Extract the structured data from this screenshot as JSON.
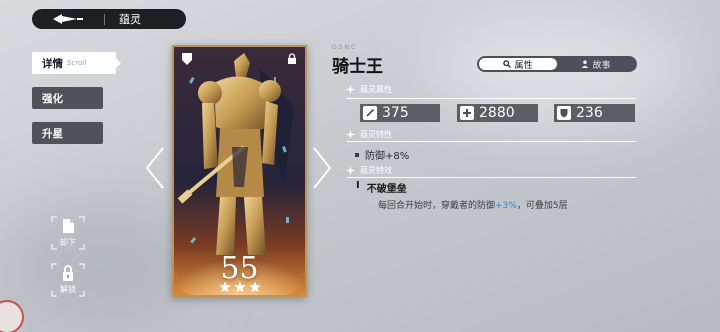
{
  "topbar": {
    "title": "蕴灵"
  },
  "nav": [
    {
      "label": "详情",
      "sub": "Scroll",
      "active": true
    },
    {
      "label": "强化",
      "active": false
    },
    {
      "label": "升星",
      "active": false
    }
  ],
  "side_actions": {
    "unequip_label": "卸下",
    "unlock_label": "解锁"
  },
  "card": {
    "level": "55",
    "stars": 3
  },
  "spirit": {
    "en_sub": "OSNC",
    "name": "骑士王"
  },
  "tabs": [
    {
      "label": "属性",
      "icon": "search-icon",
      "active": true
    },
    {
      "label": "故事",
      "icon": "person-icon",
      "active": false
    }
  ],
  "sections": {
    "attributes": "蕴灵属性",
    "traits": "蕴灵特性",
    "effect": "蕴灵特效"
  },
  "stats": [
    {
      "icon": "sword-icon",
      "value": "375"
    },
    {
      "icon": "health-cross-icon",
      "value": "2880"
    },
    {
      "icon": "shield-icon",
      "value": "236"
    }
  ],
  "trait": {
    "text": "防御+8%"
  },
  "effect": {
    "level": "I",
    "name": "不破堡垒",
    "desc_prefix": "每回合开始时，穿戴者的防御",
    "desc_highlight": "+3%",
    "desc_suffix": "，可叠加5层"
  },
  "colors": {
    "accent": "#3a86d8",
    "card_border": "#b9935a",
    "panel_dark": "#1d1f23"
  }
}
